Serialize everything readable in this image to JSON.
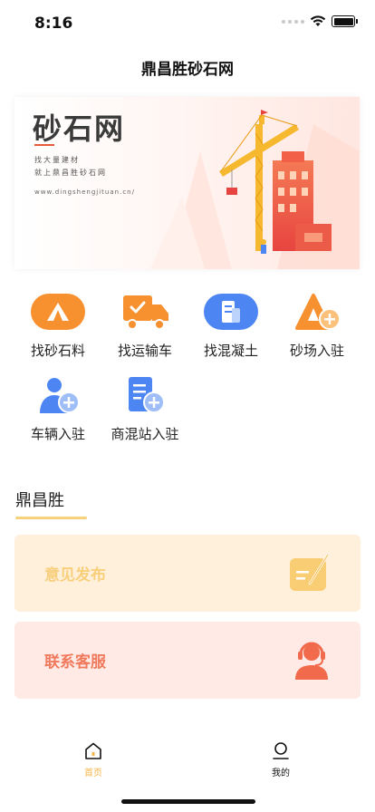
{
  "status_bar": {
    "time": "8:16"
  },
  "header": {
    "title": "鼎昌胜砂石网"
  },
  "banner": {
    "title": "砂石网",
    "line1": "找大量建材",
    "line2": "就上鼎昌胜砂石网",
    "url": "www.dingshengjituan.cn/"
  },
  "services": [
    {
      "label": "找砂石料",
      "icon": "mountain-icon"
    },
    {
      "label": "找运输车",
      "icon": "truck-icon"
    },
    {
      "label": "找混凝土",
      "icon": "document-icon"
    },
    {
      "label": "砂场入驻",
      "icon": "sand-plus-icon"
    },
    {
      "label": "车辆入驻",
      "icon": "user-plus-icon"
    },
    {
      "label": "商混站入驻",
      "icon": "document-plus-icon"
    }
  ],
  "section": {
    "title": "鼎昌胜"
  },
  "cards": {
    "feedback": {
      "label": "意见发布",
      "icon": "edit-note-icon"
    },
    "service": {
      "label": "联系客服",
      "icon": "headset-agent-icon"
    }
  },
  "tab_bar": {
    "home": {
      "label": "首页",
      "icon": "home-icon",
      "active": true
    },
    "mine": {
      "label": "我的",
      "icon": "person-icon",
      "active": false
    }
  },
  "colors": {
    "accent": "#f3b64a",
    "orange": "#f7902f",
    "blue": "#4d86f2",
    "feedback_bg": "#fff0dc",
    "service_bg": "#ffeae6"
  }
}
